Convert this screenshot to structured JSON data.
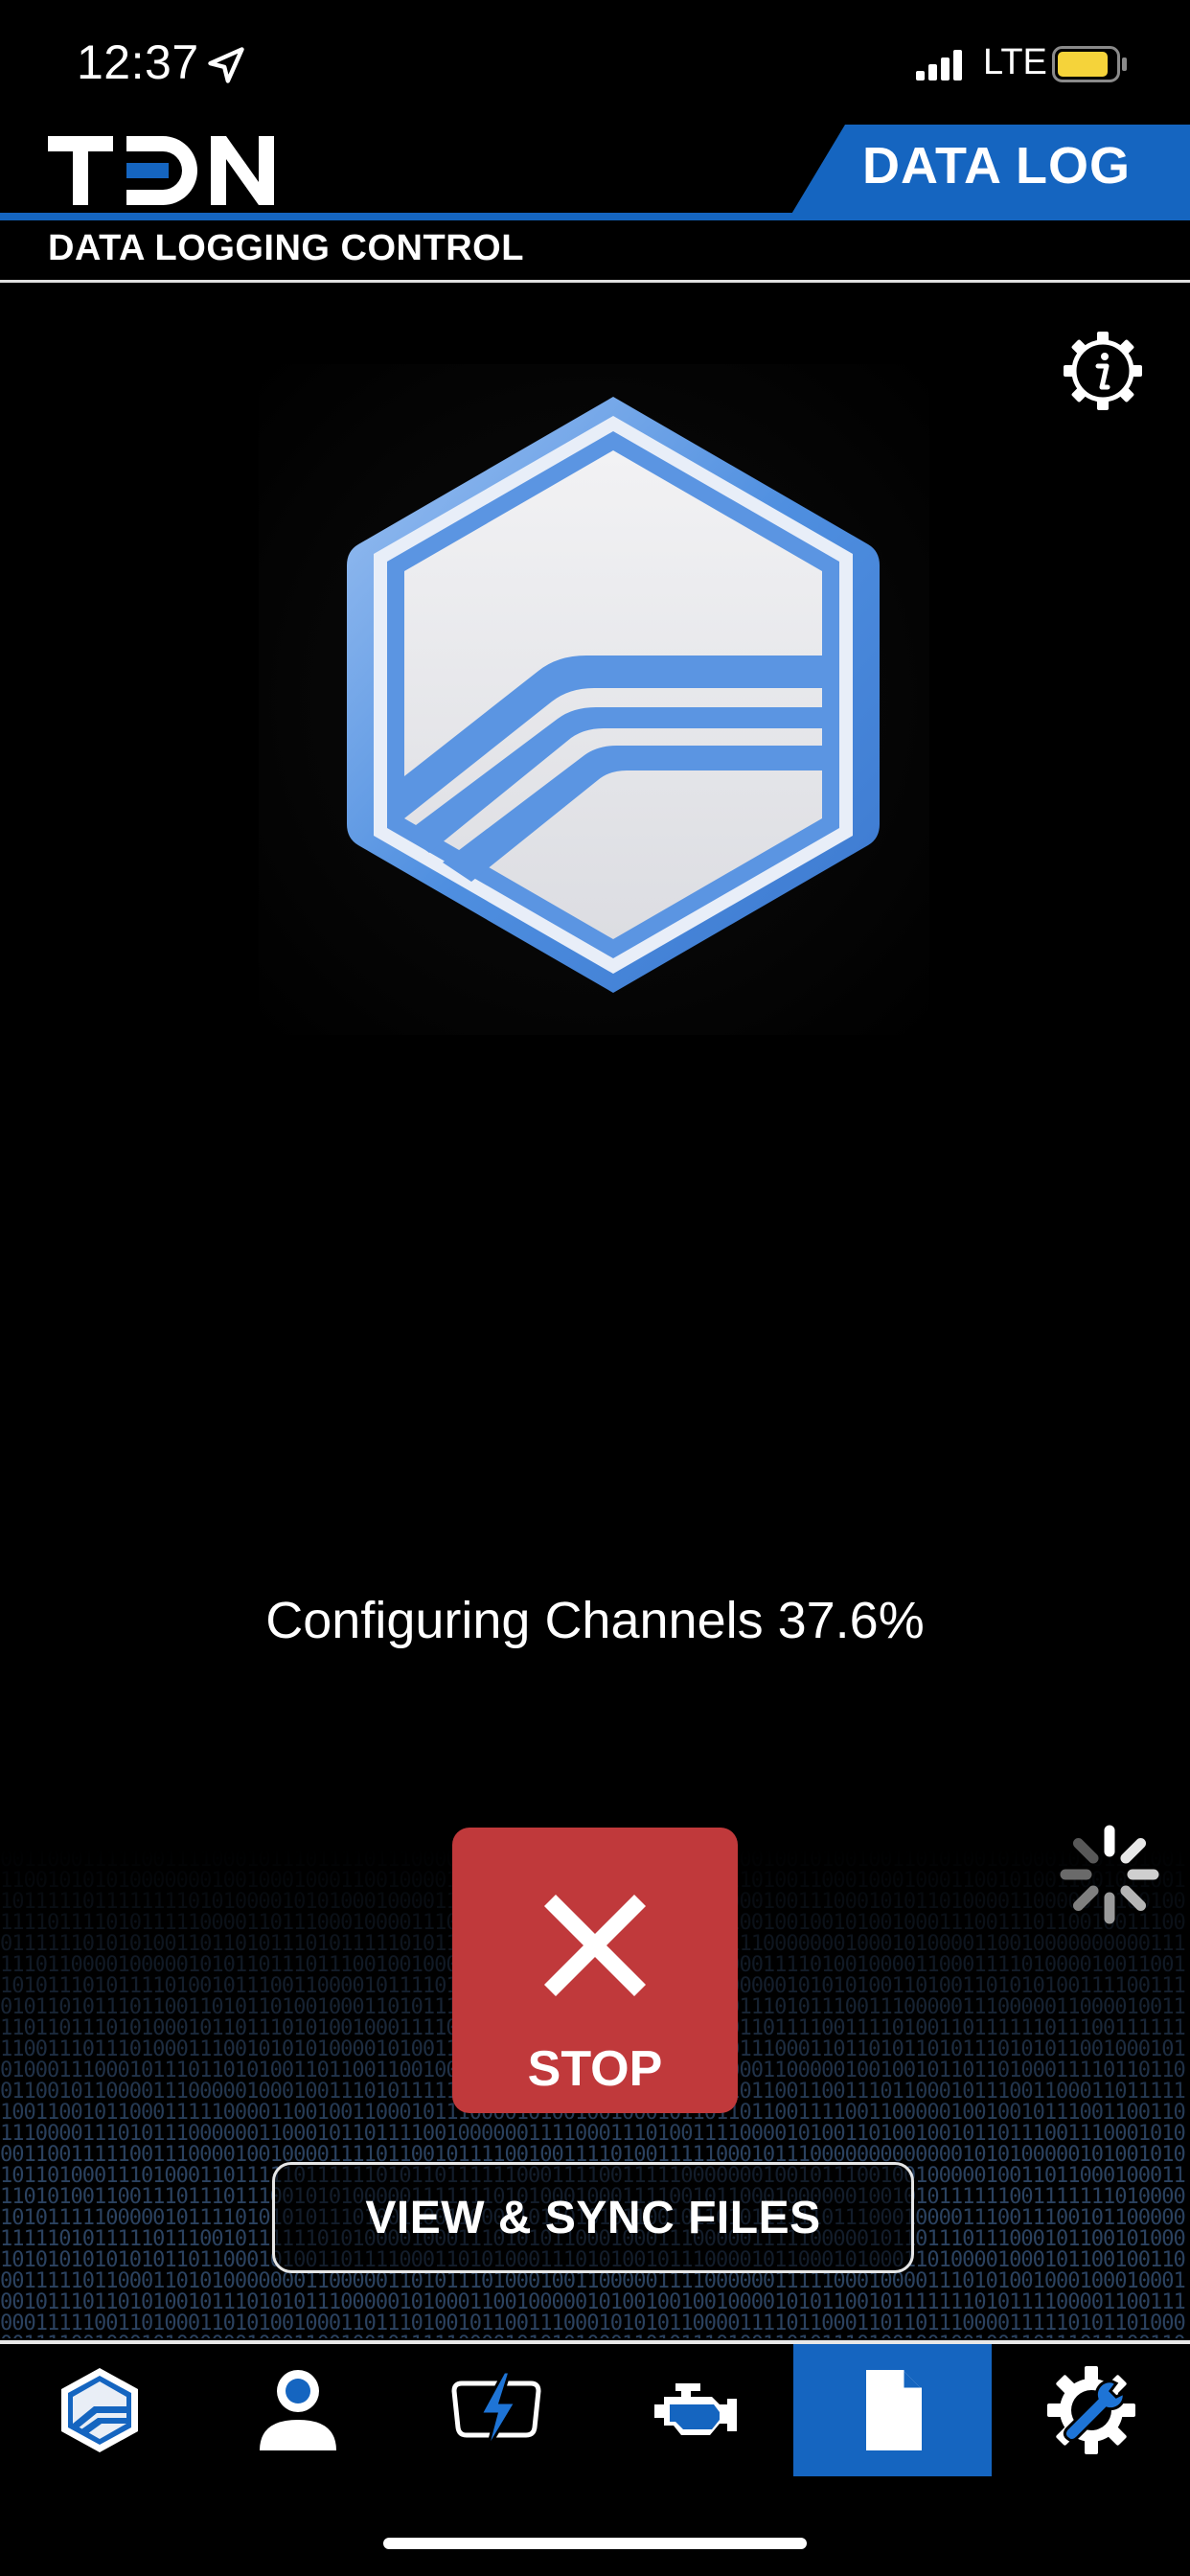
{
  "status_bar": {
    "time": "12:37",
    "network": "LTE",
    "icons": [
      "location-arrow-icon",
      "signal-bars-icon",
      "battery-icon"
    ],
    "battery_color": "#f5d33a"
  },
  "header": {
    "logo": "TDN",
    "tab_label": "DATA LOG",
    "subtitle": "DATA LOGGING CONTROL",
    "accent_color": "#1565c0"
  },
  "main": {
    "info_icon": "info-gear-icon",
    "badge_icon": "tdn-hexagon-badge-icon",
    "progress": {
      "label": "Configuring Channels 37.6%",
      "percent": 37.6
    },
    "stop_button": {
      "label": "STOP",
      "icon": "close-x-icon",
      "color": "#c0393b"
    },
    "sync_button": {
      "label": "VIEW & SYNC FILES"
    },
    "spinner_icon": "loading-spinner-icon"
  },
  "tab_bar": {
    "selected": "files",
    "items": [
      {
        "name": "home",
        "icon": "tdn-badge-icon"
      },
      {
        "name": "profile",
        "icon": "user-icon"
      },
      {
        "name": "performance",
        "icon": "lightning-icon"
      },
      {
        "name": "engine",
        "icon": "engine-icon"
      },
      {
        "name": "files",
        "icon": "document-icon"
      },
      {
        "name": "settings",
        "icon": "gear-wrench-icon"
      }
    ]
  }
}
